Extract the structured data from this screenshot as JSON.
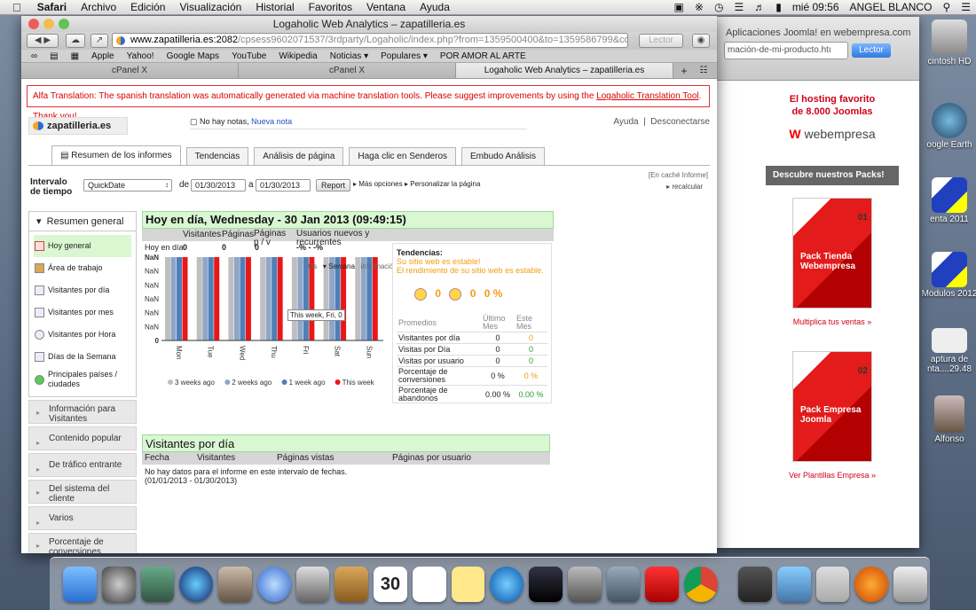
{
  "menubar": {
    "app": "Safari",
    "items": [
      "Archivo",
      "Edición",
      "Visualización",
      "Historial",
      "Favoritos",
      "Ventana",
      "Ayuda"
    ],
    "clock": "mié 09:56",
    "user": "ANGEL BLANCO"
  },
  "desktop_icons": [
    {
      "label": "cintosh HD"
    },
    {
      "label": "oogle Earth"
    },
    {
      "label": "enta 2011"
    },
    {
      "label": "Modulos 2012"
    },
    {
      "label": "aptura de nta....29.48"
    },
    {
      "label": "Alfonso"
    }
  ],
  "back_window": {
    "tab_title": "Aplicaciones Joomla! en webempresa.com",
    "url": "mación-de-mi-producto.htı",
    "reader": "Lector",
    "promo": "El hosting favorito de 8.000 Joomlas",
    "brand": "webempresa",
    "packs_header": "Descubre nuestros Packs!",
    "pack1": {
      "name": "Pack Tienda Webempresa",
      "num": "01",
      "link": "Multiplica tus ventas »"
    },
    "pack2": {
      "name": "Pack Empresa Joomla",
      "num": "02",
      "link": "Ver Plantillas Empresa »"
    }
  },
  "window": {
    "title": "Logaholic Web Analytics – zapatilleria.es",
    "url_host": "www.zapatilleria.es:2082",
    "url_rest": "/cpsess9602071537/3rdparty/Logaholic/index.php?from=1359500400&to=1359586799&conf=z",
    "reader": "Lector",
    "bookmarks": [
      "Apple",
      "Yahoo!",
      "Google Maps",
      "YouTube",
      "Wikipedia",
      "Noticias ▾",
      "Populares ▾",
      "POR AMOR AL ARTE"
    ],
    "tabs": [
      "cPanel X",
      "cPanel X",
      "Logaholic Web Analytics – zapatilleria.es"
    ]
  },
  "page": {
    "alert_text": "Alfa Translation: The spanish translation was automatically generated via machine translation tools. Please suggest improvements by using the ",
    "alert_link": "Logaholic Translation Tool",
    "alert_end": ". Thank you!",
    "logo": "zapatilleria.es",
    "notes": "No hay notas,",
    "notes_link": "Nueva nota",
    "help": "Ayuda",
    "logout": "Desconectarse",
    "tabs": [
      "Resumen de los informes",
      "Tendencias",
      "Análisis de página",
      "Haga clic en Senderos",
      "Embudo Análisis"
    ],
    "interval": {
      "label": "Intervalo de tiempo",
      "quickdate": "QuickDate",
      "de": "de",
      "from": "01/30/2013",
      "a": "a",
      "to": "01/30/2013",
      "report": "Report",
      "more": "▸ Más opciones",
      "customize": "▸ Personalizar la página",
      "cache": "[En caché Informe]",
      "recalc": "▸ recalcular"
    },
    "sidebar": {
      "header": "Resumen general",
      "items": [
        "Hoy general",
        "Área de trabajo",
        "Visitantes por día",
        "Visitantes por mes",
        "Visitantes por Hora",
        "Días de la Semana",
        "Principales países / ciudades"
      ],
      "collapsed": [
        "Información para Visitantes",
        "Contenido popular",
        "De tráfico entrante",
        "Del sistema del cliente",
        "Varios",
        "Porcentaje de conversiones"
      ]
    },
    "widget": {
      "title": "Hoy en día, Wednesday - 30 Jan 2013 (09:49:15)",
      "cols": [
        "Visitantes",
        "Páginas",
        "Páginas p / v",
        "Usuarios nuevos y recurrentes"
      ],
      "row_label": "Hoy en día",
      "row_values": [
        "0",
        "0",
        "0",
        "-% - -%"
      ],
      "chart_controls": [
        "Os",
        "Semana",
        "información"
      ],
      "tooltip": "This week, Fri, 0"
    },
    "trends": {
      "title": "Tendencias:",
      "line1": "Su sitio web es estable!",
      "line2": "El rendimiento de su sitio web es estable.",
      "val1": "0",
      "val2": "0",
      "pct": "0 %",
      "headers": [
        "Promedios",
        "Último Mes",
        "Este Mes"
      ],
      "rows": [
        [
          "Visitantes por día",
          "0",
          "0"
        ],
        [
          "Visitas por Día",
          "0",
          "0"
        ],
        [
          "Visitas por usuario",
          "0",
          "0"
        ],
        [
          "Porcentaje de conversiones",
          "0 %",
          "0 %"
        ],
        [
          "Porcentaje de abandonos",
          "0.00 %",
          "0.00 %"
        ]
      ]
    },
    "visitors": {
      "title": "Visitantes por día",
      "cols": [
        "Fecha",
        "Visitantes",
        "Páginas vistas",
        "Páginas por usuario"
      ],
      "nodata1": "No hay datos para el informe en este intervalo de fechas.",
      "nodata2": "(01/01/2013 - 01/30/2013)"
    }
  },
  "chart_data": {
    "type": "bar",
    "categories": [
      "Mon",
      "Tue",
      "Wed",
      "Thu",
      "Fri",
      "Sat",
      "Sun"
    ],
    "y_tick_labels": [
      "NaN",
      "NaN",
      "NaN",
      "NaN",
      "NaN",
      "NaN",
      "0"
    ],
    "series": [
      {
        "name": "3 weeks ago",
        "color": "#bfbfbf",
        "values": [
          0,
          0,
          0,
          0,
          0,
          0,
          0
        ]
      },
      {
        "name": "2 weeks ago",
        "color": "#8ea6c8",
        "values": [
          0,
          0,
          0,
          0,
          0,
          0,
          0
        ]
      },
      {
        "name": "1 week ago",
        "color": "#4f7fb8",
        "values": [
          0,
          0,
          0,
          0,
          0,
          0,
          0
        ]
      },
      {
        "name": "This week",
        "color": "#e81818",
        "values": [
          0,
          0,
          0,
          0,
          0,
          0,
          0
        ]
      }
    ],
    "legend": "bottom"
  }
}
